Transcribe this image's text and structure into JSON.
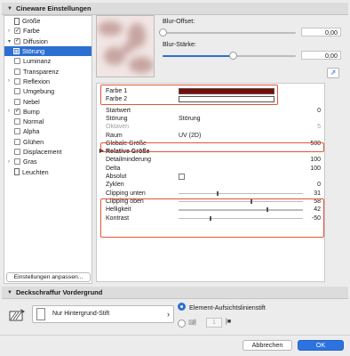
{
  "sections": {
    "cineware": "Cineware Einstellungen",
    "deckschraffur": "Deckschraffur Vordergrund"
  },
  "sidebar": {
    "items": [
      {
        "label": "Größe",
        "checkbox": false,
        "checked": false,
        "chevron": false,
        "icon": "doc"
      },
      {
        "label": "Farbe",
        "checkbox": true,
        "checked": true,
        "chevron": true
      },
      {
        "label": "Diffusion",
        "checkbox": true,
        "checked": true,
        "chevron": true
      },
      {
        "label": "Störung",
        "selected": true,
        "sub": true
      },
      {
        "label": "Luminanz",
        "checkbox": true,
        "checked": false,
        "chevron": false
      },
      {
        "label": "Transparenz",
        "checkbox": true,
        "checked": false,
        "chevron": false
      },
      {
        "label": "Reflexion",
        "checkbox": true,
        "checked": false,
        "chevron": true
      },
      {
        "label": "Umgebung",
        "checkbox": true,
        "checked": false,
        "chevron": false
      },
      {
        "label": "Nebel",
        "checkbox": true,
        "checked": false,
        "chevron": false
      },
      {
        "label": "Bump",
        "checkbox": true,
        "checked": true,
        "chevron": true
      },
      {
        "label": "Normal",
        "checkbox": true,
        "checked": false,
        "chevron": false
      },
      {
        "label": "Alpha",
        "checkbox": true,
        "checked": false,
        "chevron": false
      },
      {
        "label": "Glühen",
        "checkbox": true,
        "checked": false,
        "chevron": false
      },
      {
        "label": "Displacement",
        "checkbox": true,
        "checked": false,
        "chevron": false
      },
      {
        "label": "Gras",
        "checkbox": true,
        "checked": false,
        "chevron": true
      },
      {
        "label": "Leuchten",
        "checkbox": false,
        "checked": false,
        "chevron": false,
        "icon": "doc"
      }
    ],
    "adjust_button": "Einstellungen anpassen..."
  },
  "sliders": {
    "offset_label": "Blur-Offset:",
    "offset_value": "0,00",
    "offset_level": 0.0,
    "strength_label": "Blur-Stärke:",
    "strength_value": "0,00",
    "strength_level": 0.53
  },
  "props": [
    {
      "label": "Farbe 1",
      "swatch": "#7a0a0a"
    },
    {
      "label": "Farbe 2",
      "swatch": "#ffffff"
    },
    {
      "label": "Startwert",
      "num": "0"
    },
    {
      "label": "Störung",
      "val": "Störung"
    },
    {
      "label": "Oktaven",
      "num": "5",
      "grey": true
    },
    {
      "label": "Raum",
      "val": "UV (2D)"
    },
    {
      "label": "Globale Größe",
      "num": "500"
    },
    {
      "label": "Relative Größe",
      "bold": true,
      "tri": true
    },
    {
      "label": "Detailminderung",
      "num": "100"
    },
    {
      "label": "Delta",
      "num": "100"
    },
    {
      "label": "Absolut",
      "check": true
    },
    {
      "label": "Zyklen",
      "num": "0"
    },
    {
      "label": "Clipping unten",
      "num": "31",
      "level": 0.31
    },
    {
      "label": "Clipping oben",
      "num": "58",
      "level": 0.58
    },
    {
      "label": "Helligkeit",
      "num": "42",
      "level": 0.71
    },
    {
      "label": "Kontrast",
      "num": "-50",
      "level": 0.25
    }
  ],
  "pen": {
    "label": "Nur Hintergrund-Stift",
    "radio1": "Element-Aufsichtslinienstift",
    "radio2_num": "1"
  },
  "buttons": {
    "cancel": "Abbrechen",
    "ok": "OK"
  },
  "colors": {
    "accent": "#2d6fd1",
    "highlight": "#e0553a"
  }
}
